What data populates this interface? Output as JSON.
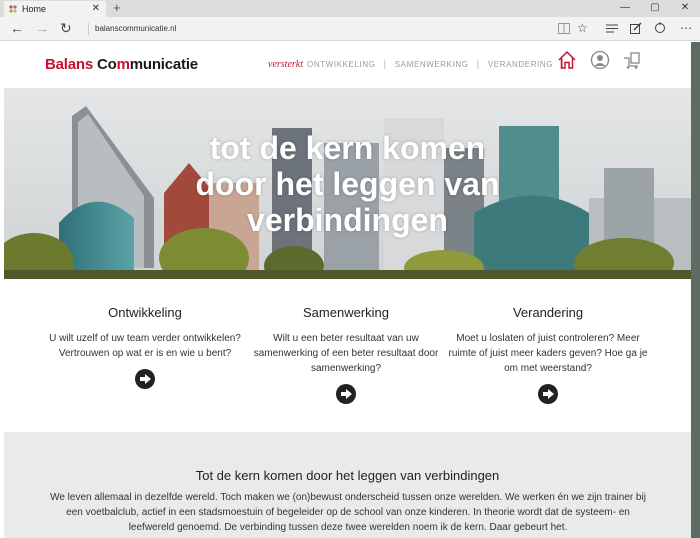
{
  "browser": {
    "tab_title": "Home",
    "tab_close": "✕",
    "new_tab": "+",
    "address": "balanscommunicatie.nl",
    "window_controls": [
      "—",
      "▢",
      "✕"
    ]
  },
  "site": {
    "logo_part1": "Balans ",
    "logo_part2": "Co",
    "logo_part3": "m",
    "logo_part4": "municatie",
    "nav_tagline": "versterkt",
    "nav_items": [
      "ONTWIKKELING",
      "SAMENWERKING",
      "VERANDERING"
    ],
    "nav_separator": "|"
  },
  "hero": {
    "headline_lines": [
      "tot de kern komen",
      "door het leggen van",
      "verbindingen"
    ]
  },
  "columns": [
    {
      "title": "Ontwikkeling",
      "text": "U wilt uzelf of uw team verder ontwikkelen? Vertrouwen op wat er is en wie u bent?"
    },
    {
      "title": "Samenwerking",
      "text": "Wilt u een beter resultaat van uw samenwerking of een beter resultaat door samenwerking?"
    },
    {
      "title": "Verandering",
      "text": "Moet u loslaten of juist controleren? Meer ruimte of juist meer kaders geven? Hoe ga je om met weerstand?"
    }
  ],
  "bottom": {
    "title": "Tot de kern komen door het leggen van verbindingen",
    "text": "We leven allemaal in dezelfde wereld. Toch maken we (on)bewust onderscheid tussen onze werelden. We werken én we zijn trainer bij een voetbalclub, actief in een stadsmoestuin of begeleider op de school van onze kinderen. In theorie wordt dat de systeem- en leefwereld genoemd. De verbinding tussen deze twee werelden noem ik de kern. Daar gebeurt het."
  },
  "colors": {
    "brand_red": "#c8102e",
    "dark": "#1a1a1a"
  },
  "icons": [
    "home-icon",
    "user-icon",
    "cart-icon",
    "back-icon",
    "forward-icon",
    "refresh-icon",
    "reading-view-icon",
    "favorite-star-icon",
    "hub-icon",
    "web-note-icon",
    "share-icon",
    "more-icon"
  ]
}
